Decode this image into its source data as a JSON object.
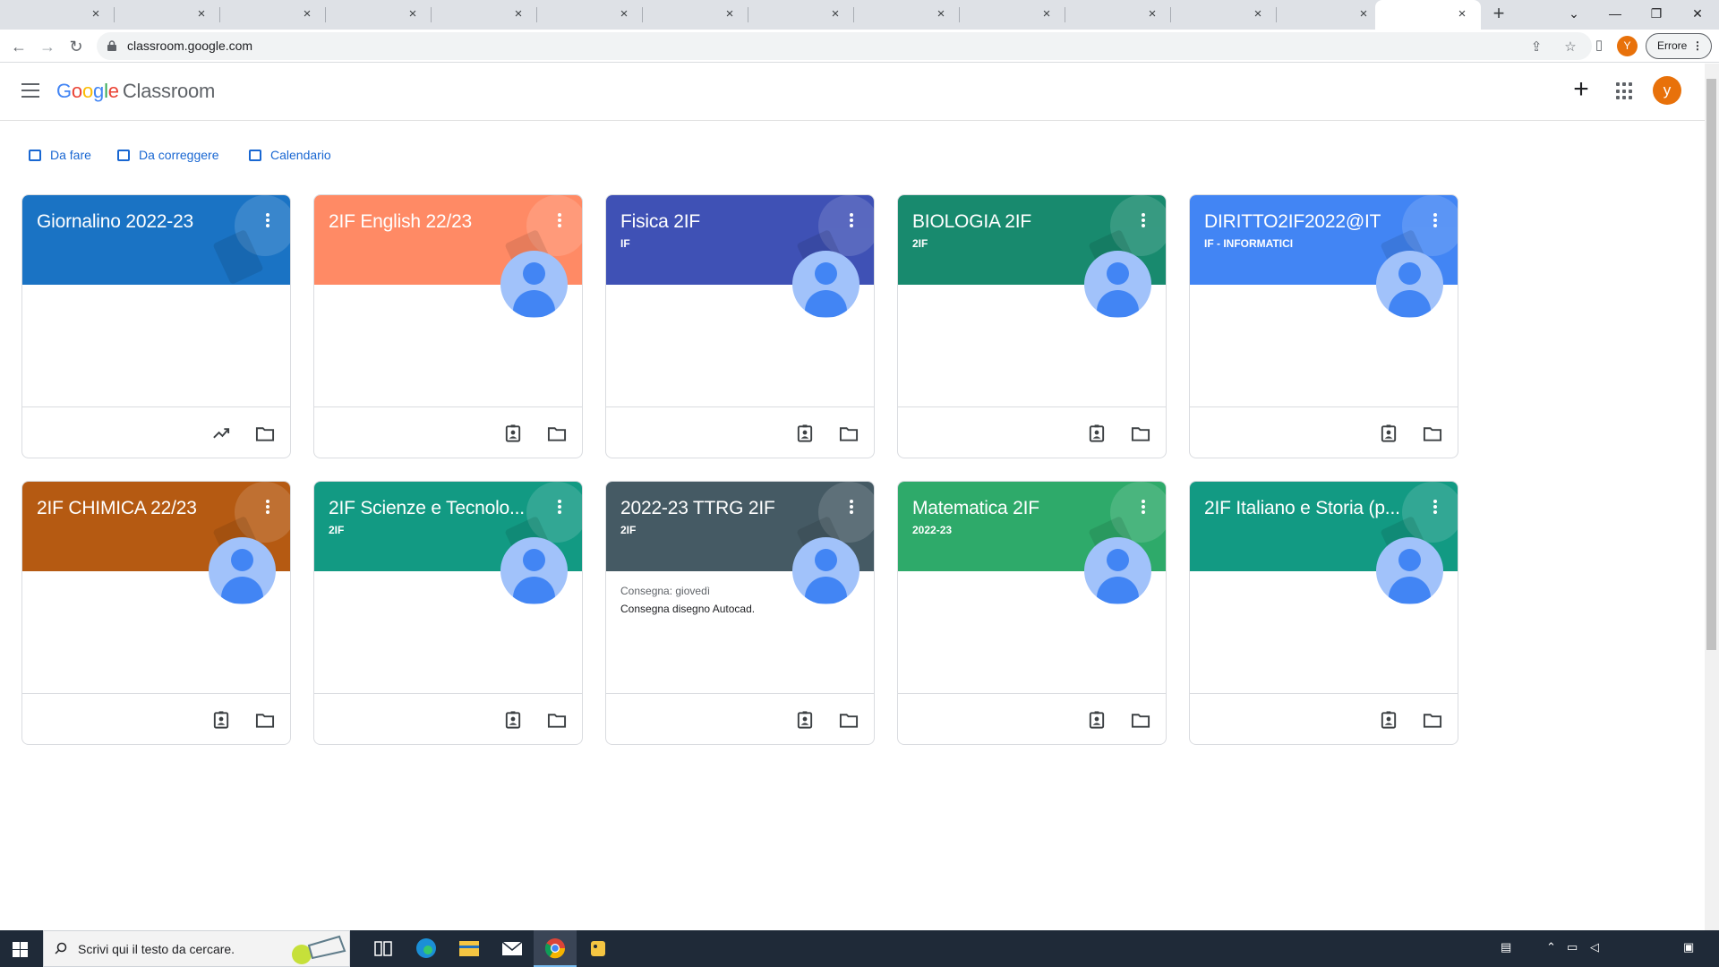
{
  "browser": {
    "url": "classroom.google.com",
    "profile_initial": "Y",
    "error_label": "Errore",
    "close_glyph": "×",
    "newtab_glyph": "+"
  },
  "app": {
    "logo_google": [
      "G",
      "o",
      "o",
      "g",
      "l",
      "e"
    ],
    "logo_product": "Classroom",
    "avatar_initial": "y",
    "create_glyph": "+"
  },
  "subnav": {
    "todo": "Da fare",
    "review": "Da correggere",
    "calendar": "Calendario"
  },
  "classes": [
    {
      "title": "Giornalino 2022-23",
      "section": "",
      "color": "#1a73c4",
      "teacher_avatar": false,
      "footer": [
        "trending-up-icon",
        "folder-icon"
      ]
    },
    {
      "title": "2IF English 22/23",
      "section": "",
      "color": "#ff8a65",
      "teacher_avatar": true,
      "footer": [
        "assignment-ind-icon",
        "folder-icon"
      ]
    },
    {
      "title": "Fisica 2IF",
      "section": "IF",
      "color": "#3f51b5",
      "teacher_avatar": true,
      "footer": [
        "assignment-ind-icon",
        "folder-icon"
      ]
    },
    {
      "title": "BIOLOGIA 2IF",
      "section": "2IF",
      "color": "#188a6e",
      "teacher_avatar": true,
      "footer": [
        "assignment-ind-icon",
        "folder-icon"
      ]
    },
    {
      "title": "DIRITTO2IF2022@IT",
      "section": "IF - INFORMATICI",
      "color": "#4285f4",
      "teacher_avatar": true,
      "footer": [
        "assignment-ind-icon",
        "folder-icon"
      ]
    },
    {
      "title": "2IF CHIMICA 22/23",
      "section": "",
      "color": "#b55a12",
      "teacher_avatar": true,
      "footer": [
        "assignment-ind-icon",
        "folder-icon"
      ]
    },
    {
      "title": "2IF Scienze e Tecnolo...",
      "section": "2IF",
      "color": "#129a83",
      "teacher_avatar": true,
      "footer": [
        "assignment-ind-icon",
        "folder-icon"
      ]
    },
    {
      "title": "2022-23 TTRG 2IF",
      "section": "2IF",
      "color": "#455a64",
      "teacher_avatar": true,
      "due_label": "Consegna: giovedì",
      "due_text": "Consegna disegno Autocad.",
      "footer": [
        "assignment-ind-icon",
        "folder-icon"
      ]
    },
    {
      "title": "Matematica 2IF",
      "section": "2022-23",
      "color": "#2eaa6a",
      "teacher_avatar": true,
      "footer": [
        "assignment-ind-icon",
        "folder-icon"
      ]
    },
    {
      "title": "2IF Italiano e Storia (p...",
      "section": "",
      "color": "#129a83",
      "teacher_avatar": true,
      "footer": [
        "assignment-ind-icon",
        "folder-icon"
      ]
    }
  ],
  "taskbar": {
    "search_placeholder": "Scrivi qui il testo da cercare."
  }
}
